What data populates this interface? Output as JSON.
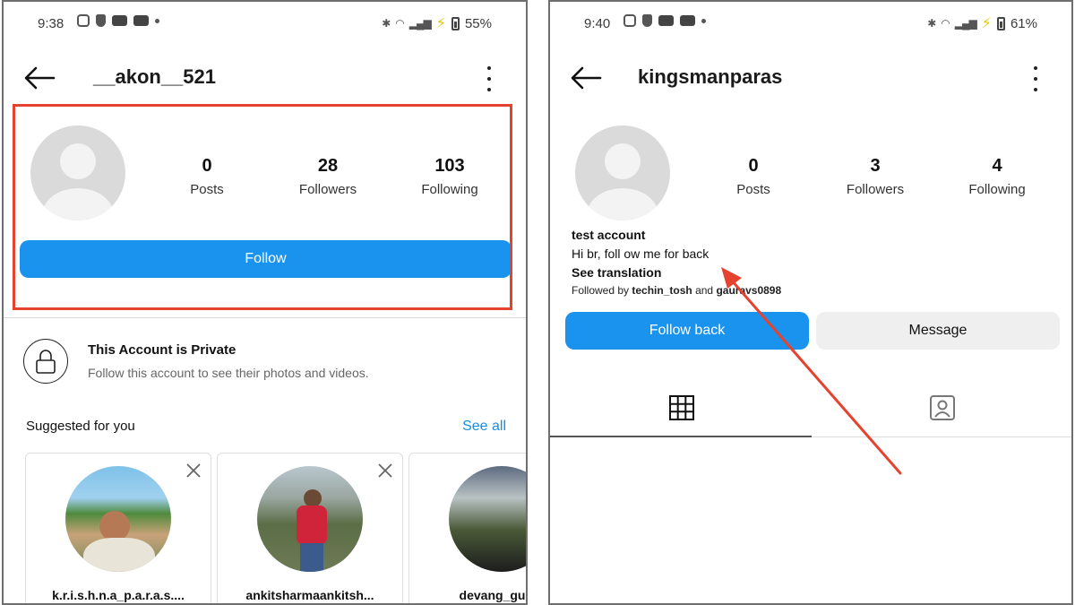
{
  "left": {
    "status": {
      "time": "9:38",
      "battery": "55%"
    },
    "username": "__akon__521",
    "stats": [
      {
        "value": "0",
        "label": "Posts"
      },
      {
        "value": "28",
        "label": "Followers"
      },
      {
        "value": "103",
        "label": "Following"
      }
    ],
    "follow_label": "Follow",
    "private": {
      "title": "This Account is Private",
      "subtitle": "Follow this account to see their photos and videos."
    },
    "suggested": {
      "title": "Suggested for you",
      "see_all": "See all",
      "cards": [
        {
          "name": "k.r.i.s.h.n.a_p.a.r.a.s...."
        },
        {
          "name": "ankitsharmaankitsh..."
        },
        {
          "name": "devang_gupta"
        }
      ]
    }
  },
  "right": {
    "status": {
      "time": "9:40",
      "battery": "61%"
    },
    "username": "kingsmanparas",
    "stats": [
      {
        "value": "0",
        "label": "Posts"
      },
      {
        "value": "3",
        "label": "Followers"
      },
      {
        "value": "4",
        "label": "Following"
      }
    ],
    "bio": {
      "name": "test account",
      "text": "Hi br, foll ow me for back",
      "see_translation": "See translation",
      "followed_by_prefix": "Followed by",
      "followed_by_user1": "techin_tosh",
      "followed_by_and": "and",
      "followed_by_user2": "gauravs0898"
    },
    "follow_back_label": "Follow back",
    "message_label": "Message"
  },
  "colors": {
    "accent": "#1a93ef",
    "highlight": "#e5432f",
    "link": "#1a8de0"
  },
  "icons": [
    "back-arrow-icon",
    "more-options-icon",
    "lock-icon",
    "close-icon",
    "grid-icon",
    "tagged-icon"
  ]
}
